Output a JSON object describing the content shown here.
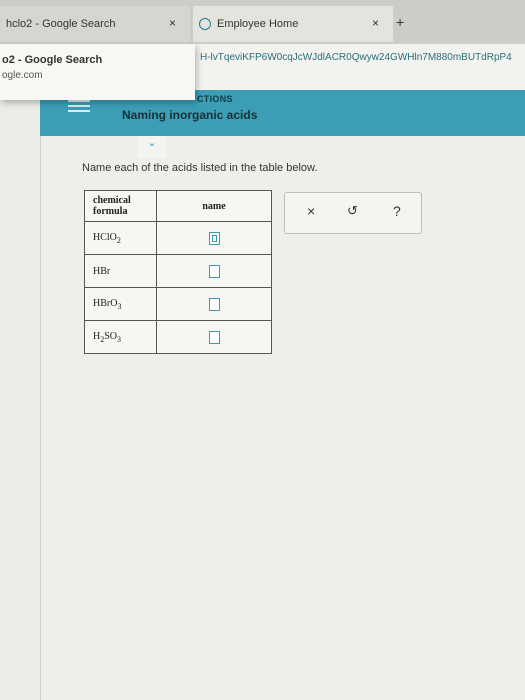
{
  "browser": {
    "tabs": [
      {
        "label": "hclo2 - Google Search",
        "close": "×"
      },
      {
        "label": "Employee Home",
        "close": "×"
      }
    ],
    "new_tab": "+",
    "url": "H-lvTqeviKFP6W0cqJcWJdlACR0Qwyw24GWHln7M880mBUTdRpP4",
    "suggestion": {
      "title": "o2 - Google Search",
      "subtitle": "ogle.com"
    }
  },
  "app": {
    "section_label": "CTIONS",
    "page_title": "Naming inorganic acids",
    "chevron": "⌄"
  },
  "question": {
    "instruction": "Name each of the acids listed in the table below.",
    "table": {
      "headers": [
        "chemical formula",
        "name"
      ],
      "rows": [
        {
          "formula": "HClO",
          "subscript": "2",
          "suffix": ""
        },
        {
          "formula": "HBr",
          "subscript": "",
          "suffix": ""
        },
        {
          "formula": "HBrO",
          "subscript": "3",
          "suffix": ""
        },
        {
          "formula": "H",
          "subscript": "2",
          "suffix": "SO",
          "subscript2": "3"
        }
      ]
    }
  },
  "tools": {
    "clear": "×",
    "undo": "↺",
    "help": "?"
  }
}
